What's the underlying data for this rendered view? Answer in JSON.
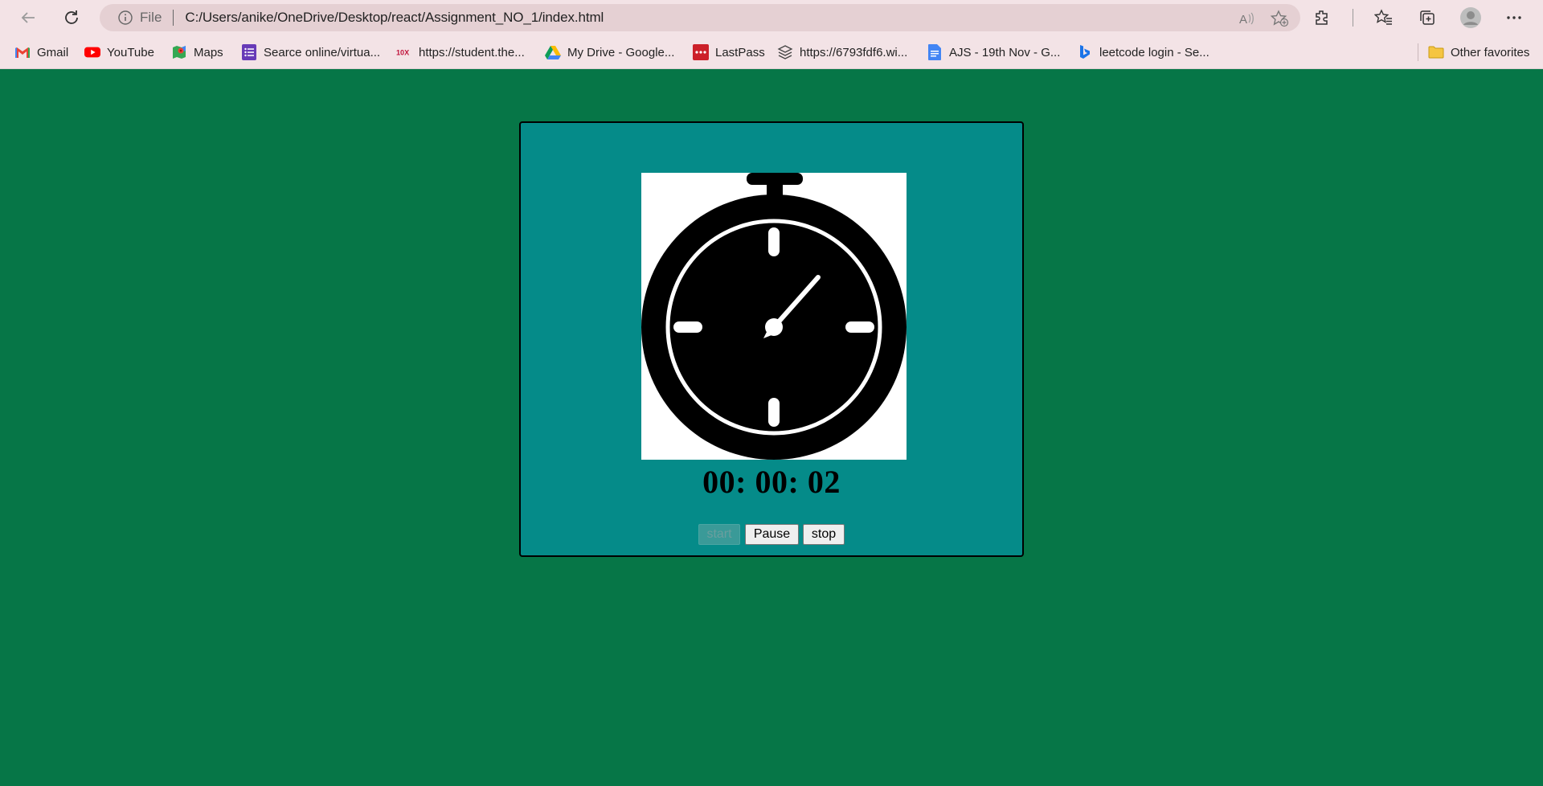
{
  "browser": {
    "address": {
      "scheme_label": "File",
      "url": "C:/Users/anike/OneDrive/Desktop/react/Assignment_NO_1/index.html"
    },
    "bookmarks": [
      {
        "label": "Gmail",
        "icon": "gmail-icon"
      },
      {
        "label": "YouTube",
        "icon": "youtube-icon"
      },
      {
        "label": "Maps",
        "icon": "maps-icon"
      },
      {
        "label": "Searce online/virtua...",
        "icon": "form-icon"
      },
      {
        "label": "https://student.the...",
        "icon": "site-icon"
      },
      {
        "label": "My Drive - Google...",
        "icon": "drive-icon"
      },
      {
        "label": "LastPass",
        "icon": "lastpass-icon"
      },
      {
        "label": "https://6793fdf6.wi...",
        "icon": "layers-icon"
      },
      {
        "label": "AJS - 19th Nov - G...",
        "icon": "docs-icon"
      },
      {
        "label": "leetcode login - Se...",
        "icon": "bing-icon"
      }
    ],
    "other_favorites": "Other favorites"
  },
  "stopwatch": {
    "time": "00: 00: 02",
    "buttons": {
      "start": "start",
      "pause": "Pause",
      "stop": "stop"
    },
    "start_disabled": true
  },
  "colors": {
    "page_background": "#067647",
    "card_background": "#058b89",
    "chrome_background": "#f3e3e6"
  }
}
